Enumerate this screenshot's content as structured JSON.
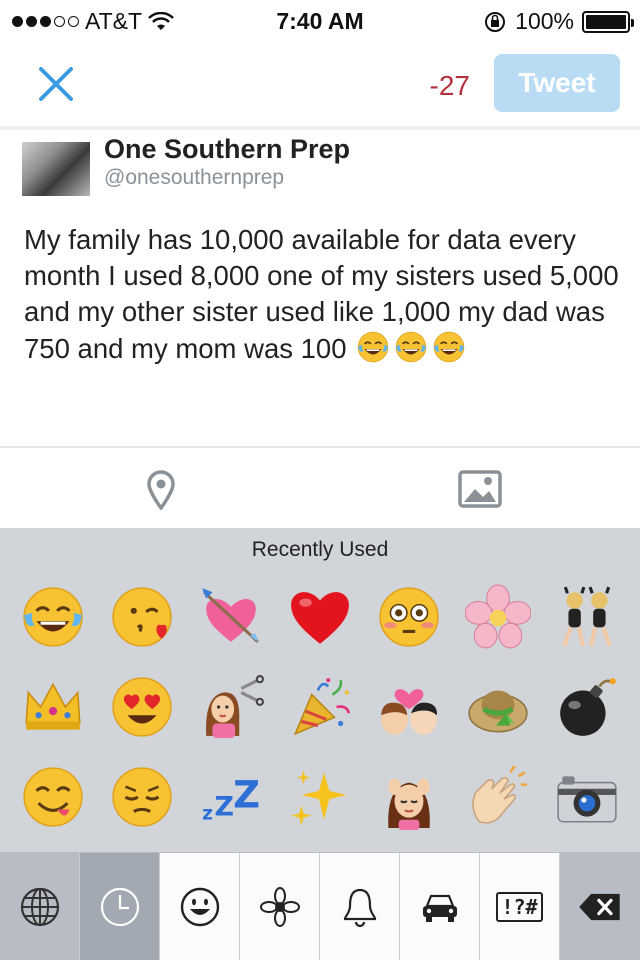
{
  "status_bar": {
    "carrier": "AT&T",
    "time": "7:40 AM",
    "battery_percent": "100%",
    "signal_bars_filled": 3,
    "signal_bars_total": 5
  },
  "compose": {
    "close_icon": "close-icon",
    "char_count": "-27",
    "tweet_label": "Tweet",
    "tweet_button_color": "#b9dbf4",
    "counter_color": "#b5313e"
  },
  "tweet": {
    "display_name": "One Southern Prep",
    "handle": "@onesouthernprep",
    "text": "My family has 10,000 available for data every month I used 8,000 one of my sisters used 5,000 and my other sister used like 1,000 my dad was 750 and my mom was 100",
    "trailing_emoji": [
      "tears-of-joy",
      "tears-of-joy",
      "tears-of-joy"
    ]
  },
  "toolbar": {
    "location_icon": "location-pin-icon",
    "photo_icon": "photo-icon"
  },
  "keyboard": {
    "section_title": "Recently Used",
    "emoji": [
      "face-with-tears-of-joy",
      "face-throwing-kiss",
      "heart-with-arrow",
      "red-heart",
      "flushed-face",
      "cherry-blossom",
      "dancers",
      "crown",
      "heart-eyes-face",
      "haircut",
      "party-popper",
      "kiss",
      "hat",
      "bomb",
      "yum-face",
      "pensive-face",
      "zzz",
      "sparkles",
      "face-massage",
      "clapping-hands",
      "camera"
    ],
    "bottom_keys": [
      "globe-icon",
      "recent-clock-icon",
      "smiley-icon",
      "flower-icon",
      "bell-icon",
      "car-icon",
      "symbols-icon",
      "delete-icon"
    ],
    "symbols_label": "!?#"
  }
}
